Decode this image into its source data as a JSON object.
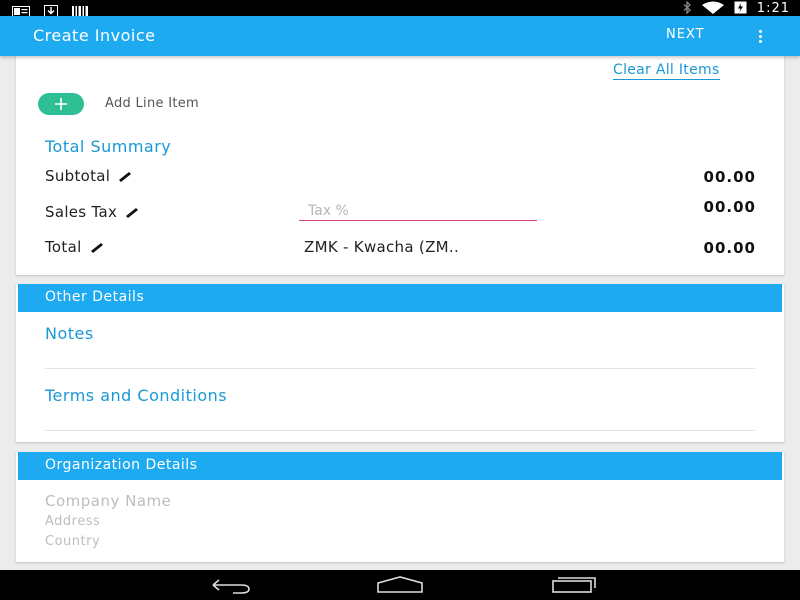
{
  "status_bar": {
    "time": "1:21",
    "icons": [
      "notification-card-icon",
      "download-icon",
      "barcode-icon",
      "bluetooth-icon",
      "wifi-icon",
      "battery-charging-icon"
    ]
  },
  "app_bar": {
    "title": "Create Invoice",
    "next_label": "NEXT",
    "menu_icon": "more-vert-icon"
  },
  "line_items": {
    "clear_all_label": "Clear All Items",
    "add_label": "Add Line Item",
    "add_icon": "plus-icon",
    "add_color": "#2fbf95"
  },
  "summary": {
    "title": "Total Summary",
    "subtotal_label": "Subtotal",
    "subtotal_value": "00.00",
    "sales_tax_label": "Sales Tax",
    "tax_placeholder": "Tax %",
    "tax_value": "00.00",
    "total_label": "Total",
    "currency": "ZMK - Kwacha (ZM..",
    "total_value": "00.00",
    "edit_icon": "pencil-icon"
  },
  "other_details": {
    "header": "Other Details",
    "notes_label": "Notes",
    "terms_label": "Terms and Conditions"
  },
  "organization": {
    "header": "Organization Details",
    "company_placeholder": "Company Name",
    "address_placeholder": "Address",
    "country_placeholder": "Country"
  },
  "nav_bar": {
    "icons": [
      "back-icon",
      "home-icon",
      "recent-apps-icon"
    ]
  },
  "colors": {
    "primary": "#1eaaf1",
    "accent_text": "#1a98d5",
    "tax_underline": "#e0437a"
  }
}
